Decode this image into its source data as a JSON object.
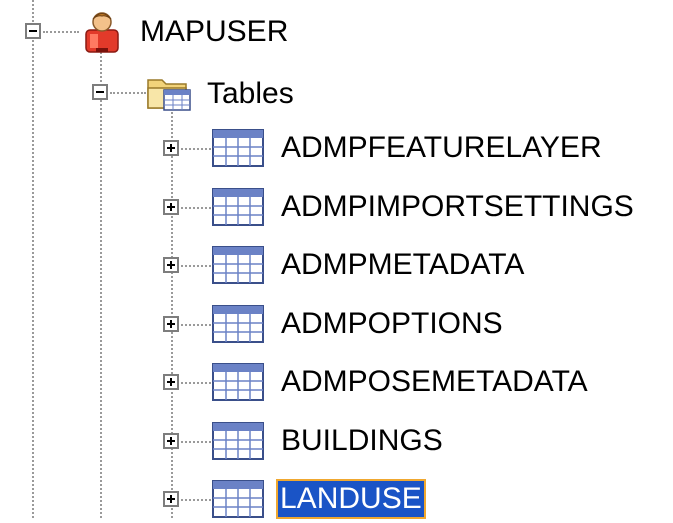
{
  "tree": {
    "root": {
      "label": "MAPUSER",
      "icon": "user-icon",
      "expanded": true
    },
    "folder": {
      "label": "Tables",
      "icon": "folder-icon",
      "expanded": true
    },
    "tables": [
      {
        "label": "ADMPFEATURELAYER",
        "icon": "table-icon",
        "selected": false
      },
      {
        "label": "ADMPIMPORTSETTINGS",
        "icon": "table-icon",
        "selected": false
      },
      {
        "label": "ADMPMETADATA",
        "icon": "table-icon",
        "selected": false
      },
      {
        "label": "ADMPOPTIONS",
        "icon": "table-icon",
        "selected": false
      },
      {
        "label": "ADMPOSEMETADATA",
        "icon": "table-icon",
        "selected": false
      },
      {
        "label": "BUILDINGS",
        "icon": "table-icon",
        "selected": false
      },
      {
        "label": "LANDUSE",
        "icon": "table-icon",
        "selected": true
      }
    ],
    "colors": {
      "selection": "#1a54c6",
      "selection_border": "#f0a830",
      "guide_lines": "#9a9a9a"
    }
  }
}
